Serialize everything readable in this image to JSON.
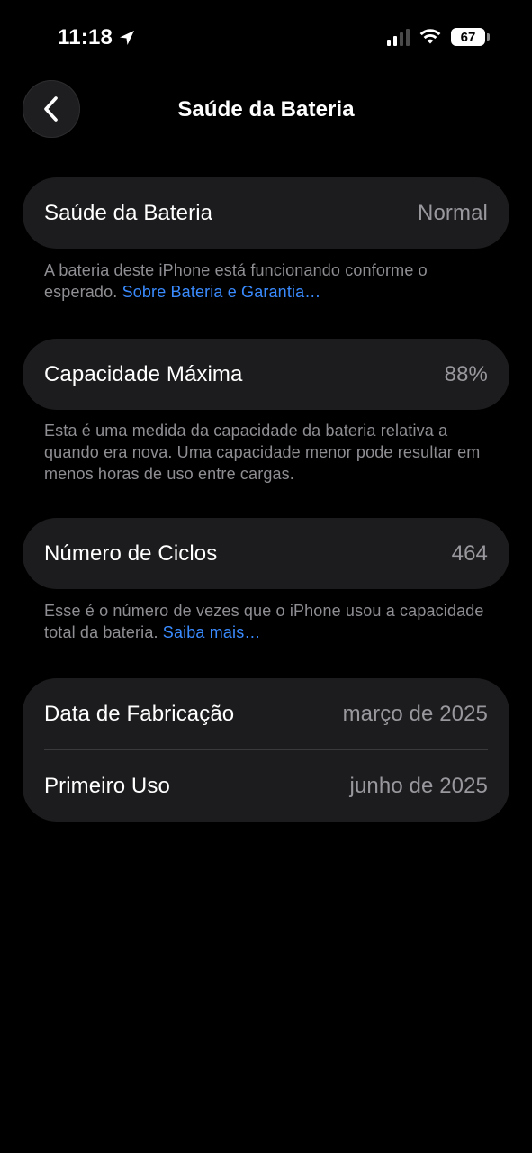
{
  "status_bar": {
    "time": "11:18",
    "battery": "67"
  },
  "nav": {
    "title": "Saúde da Bateria"
  },
  "health": {
    "label": "Saúde da Bateria",
    "value": "Normal",
    "note": "A bateria deste iPhone está funcionando conforme o esperado.",
    "link": "Sobre Bateria e Garantia…"
  },
  "capacity": {
    "label": "Capacidade Máxima",
    "value": "88%",
    "note": "Esta é uma medida da capacidade da bateria relativa a quando era nova. Uma capacidade menor pode resultar em menos horas de uso entre cargas."
  },
  "cycles": {
    "label": "Número de Ciclos",
    "value": "464",
    "note": "Esse é o número de vezes que o iPhone usou a capacidade total da bateria.",
    "link": "Saiba mais…"
  },
  "dates": {
    "manufacture_label": "Data de Fabricação",
    "manufacture_value": "março de 2025",
    "first_use_label": "Primeiro Uso",
    "first_use_value": "junho de 2025"
  },
  "colors": {
    "background": "#000000",
    "card": "#1c1c1e",
    "secondary_text": "#98989d",
    "link": "#3a8bff"
  },
  "icons": {
    "back": "chevron-left-icon",
    "location": "location-arrow-icon",
    "signal": "cellular-signal-icon",
    "wifi": "wifi-icon",
    "battery": "battery-icon"
  }
}
